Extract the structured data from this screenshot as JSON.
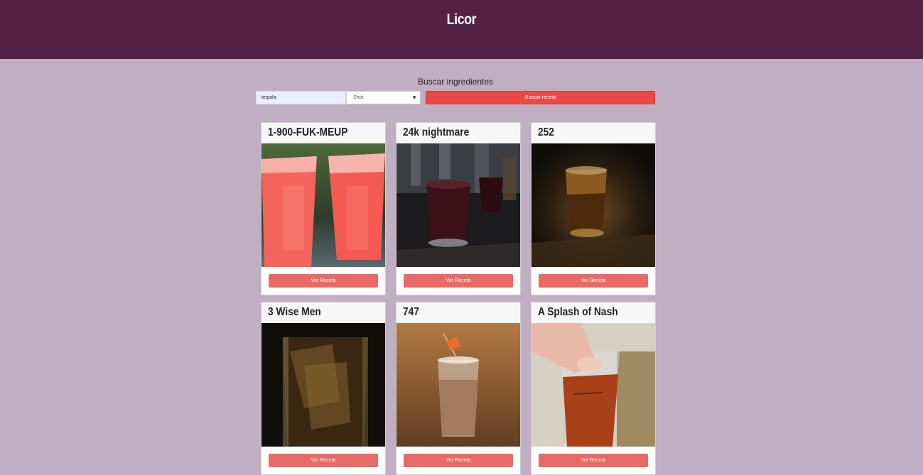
{
  "header": {
    "title": "Licor"
  },
  "search": {
    "label": "Buscar ingredientes",
    "input_value": "tequila",
    "category_selected": "Shot",
    "button_label": "Buscar receta"
  },
  "cards": [
    {
      "title": "1-900-FUK-MEUP",
      "button": "Ver Receta"
    },
    {
      "title": "24k nightmare",
      "button": "Ver Receta"
    },
    {
      "title": "252",
      "button": "Ver Receta"
    },
    {
      "title": "3 Wise Men",
      "button": "Ver Receta"
    },
    {
      "title": "747",
      "button": "Ver Receta"
    },
    {
      "title": "A Splash of Nash",
      "button": "Ver Receta"
    }
  ],
  "colors": {
    "header_bg": "#532145",
    "page_bg": "#c0aec3",
    "primary_button": "#e84b47",
    "card_button": "#e86a66"
  }
}
